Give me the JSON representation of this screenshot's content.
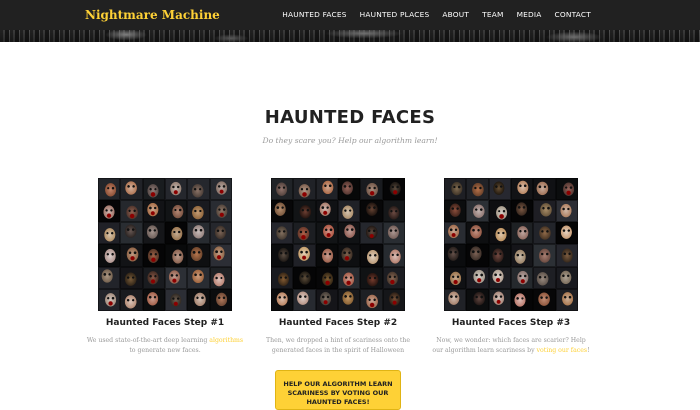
{
  "navbar": {
    "brand": "Nightmare Machine",
    "links": [
      "HAUNTED FACES",
      "HAUNTED PLACES",
      "ABOUT",
      "TEAM",
      "MEDIA",
      "CONTACT"
    ]
  },
  "section": {
    "title": "HAUNTED FACES",
    "subtitle": "Do they scare you? Help our algorithm learn!"
  },
  "steps": [
    {
      "title": "Haunted Faces Step #1",
      "text_before": "We used state-of-the-art deep learning ",
      "link": "algorithms",
      "text_after": " to generate new faces."
    },
    {
      "title": "Haunted Faces Step #2",
      "text": "Then, we dropped a hint of scariness onto the generated faces in the spirit of Halloween"
    },
    {
      "title": "Haunted Faces Step #3",
      "text_before": "Now, we wonder: which faces are scarier? Help our algorithm learn scariness by ",
      "link": "voting our faces",
      "text_after": "!"
    }
  ],
  "cta": {
    "label": "HELP OUR ALGORITHM LEARN SCARINESS BY VOTING OUR HAUNTED FACES!"
  },
  "colors": {
    "accent": "#fed136",
    "navbar": "#212121",
    "muted_text": "#9a9a9a"
  }
}
